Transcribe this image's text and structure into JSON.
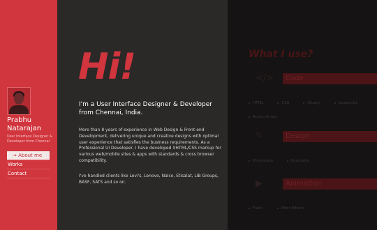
{
  "profile": {
    "name": "Prabhu Natarajan",
    "role": "User Interface Designer & Developer from Chennai"
  },
  "nav": [
    {
      "label": "→ About me",
      "active": true
    },
    {
      "label": "Works",
      "active": false
    },
    {
      "label": "Contact",
      "active": false
    }
  ],
  "hero": {
    "greeting": "Hi!",
    "intro": "I'm a User Interface Designer & Developer from Chennai, India.",
    "paragraph1": "More than 8 years of experience in Web Design & Front-end Development, delivering unique and creative designs with optimal user experience that satisfies the business requirements. As a Professional UI Developer, I have developed XHTML/CSS markup for various web/mobile sites & apps with standards & cross browser compatibility.",
    "paragraph2": "I've handled clients like Levi's, Lenovo, Nalco, Etisalat, LIB Groups, BASF, SATS and so on."
  },
  "tools": {
    "title": "What I use?",
    "sections": [
      {
        "icon": "</>",
        "title": "Code",
        "items": [
          "HTML",
          "CSS",
          "jQuery",
          "Javascript",
          "Action Script"
        ]
      },
      {
        "icon": "✎",
        "title": "Design",
        "items": [
          "Photoshop",
          "Illustrator"
        ]
      },
      {
        "icon": "▶",
        "title": "Animation",
        "items": [
          "Flash",
          "After Effects"
        ]
      }
    ]
  },
  "colors": {
    "accent": "#d1353d",
    "middle_bg": "#2b2828",
    "right_bg": "#151313"
  }
}
